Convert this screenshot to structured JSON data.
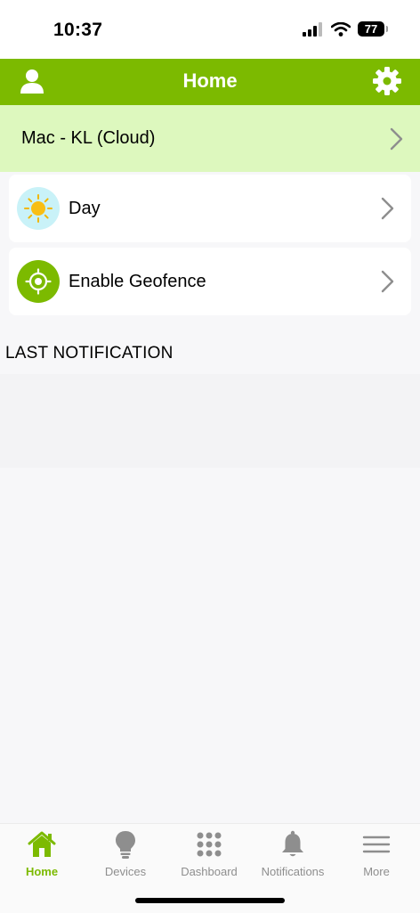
{
  "status_bar": {
    "time": "10:37",
    "battery": "77"
  },
  "header": {
    "title": "Home",
    "profile_icon": "person-icon",
    "settings_icon": "gear-icon"
  },
  "location": {
    "label": "Mac - KL (Cloud)"
  },
  "cards": [
    {
      "label": "Day",
      "icon": "sun-icon"
    },
    {
      "label": "Enable Geofence",
      "icon": "geofence-target-icon"
    }
  ],
  "section": {
    "title": "LAST NOTIFICATION"
  },
  "tabs": [
    {
      "label": "Home",
      "icon": "home-icon",
      "active": true
    },
    {
      "label": "Devices",
      "icon": "bulb-icon",
      "active": false
    },
    {
      "label": "Dashboard",
      "icon": "grid-icon",
      "active": false
    },
    {
      "label": "Notifications",
      "icon": "bell-icon",
      "active": false
    },
    {
      "label": "More",
      "icon": "menu-icon",
      "active": false
    }
  ],
  "colors": {
    "accent": "#7cba00",
    "location_bg": "#ddf8be",
    "inactive": "#8e8e8e"
  }
}
